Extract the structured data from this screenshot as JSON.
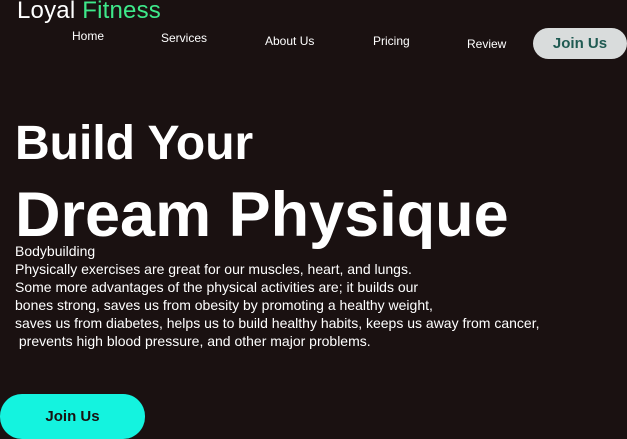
{
  "logo": {
    "part1": "Loyal",
    "part2": "Fitness",
    "accent_color": "#3ee88a"
  },
  "nav": {
    "items": [
      {
        "label": "Home"
      },
      {
        "label": "Services"
      },
      {
        "label": "About Us"
      },
      {
        "label": "Pricing"
      },
      {
        "label": "Review"
      }
    ],
    "join_label": "Join Us"
  },
  "hero": {
    "line1": "Build Your",
    "line2": "Dream Physique",
    "tag": "Bodybuilding",
    "description": "Physically exercises are great for our muscles, heart, and lungs.\nSome more advantages of the physical activities are; it builds our\nbones strong, saves us from obesity by promoting a healthy weight,\nsaves us from diabetes, helps us to build healthy habits, keeps us away from cancer,\n prevents high blood pressure, and other major problems.",
    "cta_label": "Join Us"
  },
  "colors": {
    "background": "#1a1111",
    "cta": "#14f3df",
    "nav_button_bg": "#d9dcdc",
    "nav_button_text": "#1f5a52"
  }
}
